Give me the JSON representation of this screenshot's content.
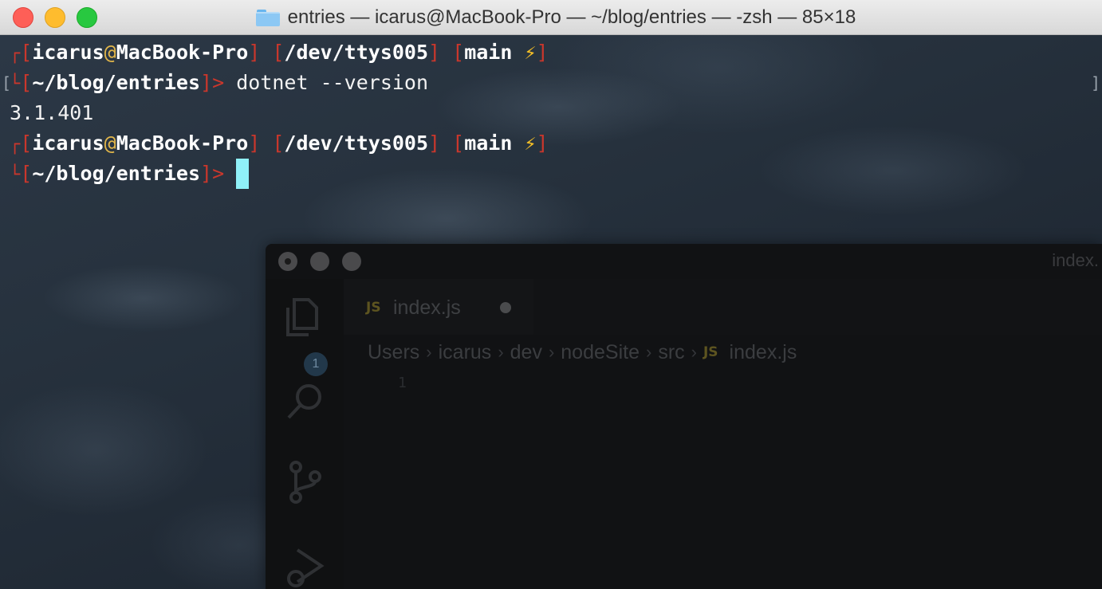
{
  "window": {
    "title": "entries — icarus@MacBook-Pro — ~/blog/entries — -zsh — 85×18"
  },
  "terminal": {
    "prompt1": {
      "user": "icarus",
      "at": "@",
      "host": "MacBook-Pro",
      "tty": "/dev/ttys005",
      "branch": "main",
      "bolt": "⚡",
      "cwd": "~/blog/entries",
      "command": "dotnet --version"
    },
    "output": "3.1.401",
    "prompt2": {
      "user": "icarus",
      "at": "@",
      "host": "MacBook-Pro",
      "tty": "/dev/ttys005",
      "branch": "main",
      "bolt": "⚡",
      "cwd": "~/blog/entries"
    }
  },
  "editor": {
    "title": "index.",
    "tab_label": "index.js",
    "js_tag": "JS",
    "explorer_badge": "1",
    "breadcrumbs": [
      "Users",
      "icarus",
      "dev",
      "nodeSite",
      "src"
    ],
    "breadcrumb_file": "index.js",
    "line_number": "1",
    "icons": [
      "files-icon",
      "search-icon",
      "source-control-icon",
      "run-debug-icon"
    ]
  },
  "colors": {
    "prompt_red": "#c9372c",
    "cursor": "#8ff0f8",
    "bolt": "#f6c026"
  }
}
